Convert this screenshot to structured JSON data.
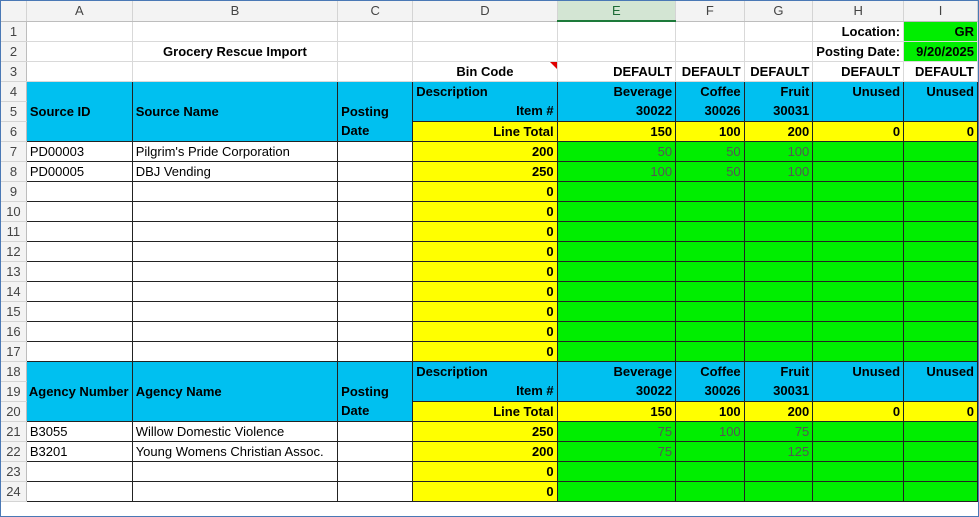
{
  "columns": [
    "A",
    "B",
    "C",
    "D",
    "E",
    "F",
    "G",
    "H",
    "I"
  ],
  "rows": [
    "1",
    "2",
    "3",
    "4",
    "5",
    "6",
    "7",
    "8",
    "9",
    "10",
    "11",
    "12",
    "13",
    "14",
    "15",
    "16",
    "17",
    "18",
    "19",
    "20",
    "21",
    "22",
    "23",
    "24"
  ],
  "header": {
    "location_label": "Location:",
    "location_value": "GR",
    "title": "Grocery Rescue Import",
    "posting_date_label": "Posting Date:",
    "posting_date_value": "9/20/2025",
    "bin_code_label": "Bin Code",
    "bin_codes": [
      "DEFAULT",
      "DEFAULT",
      "DEFAULT",
      "DEFAULT",
      "DEFAULT"
    ]
  },
  "source_block": {
    "id_label": "Source ID",
    "name_label": "Source Name",
    "posting_label_1": "Posting",
    "posting_label_2": "Date",
    "description_label": "Description",
    "item_label": "Item #",
    "line_total_label": "Line Total",
    "descriptions": [
      "Beverage",
      "Coffee",
      "Fruit",
      "Unused",
      "Unused"
    ],
    "items": [
      "30022",
      "30026",
      "30031",
      "",
      ""
    ],
    "totals": [
      "150",
      "100",
      "200",
      "0",
      "0"
    ],
    "rows": [
      {
        "id": "PD00003",
        "name": "Pilgrim's Pride Corporation",
        "total": "200",
        "e": "50",
        "f": "50",
        "g": "100"
      },
      {
        "id": "PD00005",
        "name": "DBJ Vending",
        "total": "250",
        "e": "100",
        "f": "50",
        "g": "100"
      },
      {
        "id": "",
        "name": "",
        "total": "0",
        "e": "",
        "f": "",
        "g": ""
      },
      {
        "id": "",
        "name": "",
        "total": "0",
        "e": "",
        "f": "",
        "g": ""
      },
      {
        "id": "",
        "name": "",
        "total": "0",
        "e": "",
        "f": "",
        "g": ""
      },
      {
        "id": "",
        "name": "",
        "total": "0",
        "e": "",
        "f": "",
        "g": ""
      },
      {
        "id": "",
        "name": "",
        "total": "0",
        "e": "",
        "f": "",
        "g": ""
      },
      {
        "id": "",
        "name": "",
        "total": "0",
        "e": "",
        "f": "",
        "g": ""
      },
      {
        "id": "",
        "name": "",
        "total": "0",
        "e": "",
        "f": "",
        "g": ""
      },
      {
        "id": "",
        "name": "",
        "total": "0",
        "e": "",
        "f": "",
        "g": ""
      },
      {
        "id": "",
        "name": "",
        "total": "0",
        "e": "",
        "f": "",
        "g": ""
      }
    ]
  },
  "agency_block": {
    "number_label": "Agency Number",
    "name_label": "Agency Name",
    "posting_label_1": "Posting",
    "posting_label_2": "Date",
    "description_label": "Description",
    "item_label": "Item #",
    "line_total_label": "Line Total",
    "descriptions": [
      "Beverage",
      "Coffee",
      "Fruit",
      "Unused",
      "Unused"
    ],
    "items": [
      "30022",
      "30026",
      "30031",
      "",
      ""
    ],
    "totals": [
      "150",
      "100",
      "200",
      "0",
      "0"
    ],
    "rows": [
      {
        "id": "B3055",
        "name": "Willow Domestic Violence",
        "total": "250",
        "e": "75",
        "f": "100",
        "g": "75"
      },
      {
        "id": "B3201",
        "name": "Young Womens Christian Assoc.",
        "total": "200",
        "e": "75",
        "f": "",
        "g": "125"
      },
      {
        "id": "",
        "name": "",
        "total": "0",
        "e": "",
        "f": "",
        "g": ""
      },
      {
        "id": "",
        "name": "",
        "total": "0",
        "e": "",
        "f": "",
        "g": ""
      }
    ]
  }
}
